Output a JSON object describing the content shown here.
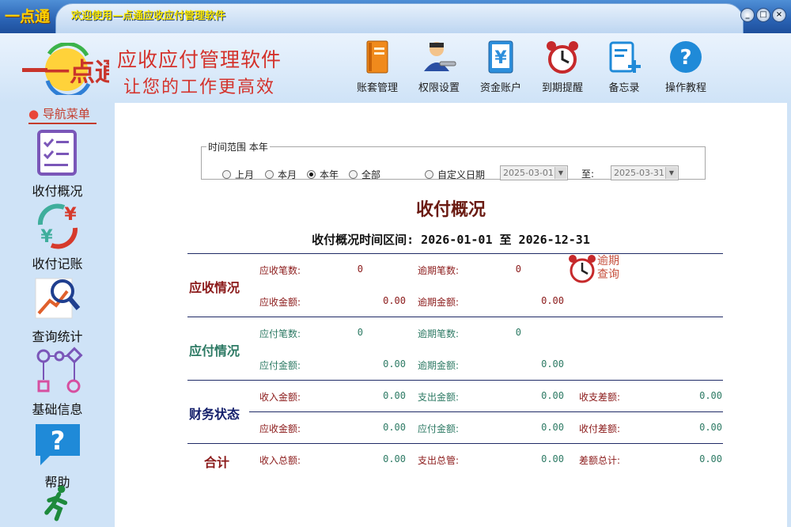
{
  "titlebar": {
    "logo": "一点通",
    "title": "欢迎使用—点通应收应付管理软件",
    "buttons": [
      "_",
      "□",
      "×"
    ]
  },
  "brand": {
    "logo": "一点通",
    "line1": "应收应付管理软件",
    "line2": "让您的工作更高效"
  },
  "toolbar": [
    {
      "label": "账套管理",
      "icon": "ledger-book-icon"
    },
    {
      "label": "权限设置",
      "icon": "user-key-icon"
    },
    {
      "label": "资金账户",
      "icon": "yuan-account-icon"
    },
    {
      "label": "到期提醒",
      "icon": "alarm-clock-icon"
    },
    {
      "label": "备忘录",
      "icon": "memo-add-icon"
    },
    {
      "label": "操作教程",
      "icon": "help-question-icon"
    }
  ],
  "sidebar": {
    "title": "导航菜单",
    "items": [
      {
        "label": "收付概况",
        "icon": "checklist-icon"
      },
      {
        "label": "收付记账",
        "icon": "yuan-exchange-icon"
      },
      {
        "label": "查询统计",
        "icon": "magnifier-chart-icon"
      },
      {
        "label": "基础信息",
        "icon": "flow-diagram-icon"
      },
      {
        "label": "帮助",
        "icon": "help-bubble-icon"
      },
      {
        "label": "",
        "icon": "running-man-icon"
      }
    ]
  },
  "range": {
    "legend": "时间范围 本年",
    "options": [
      "上月",
      "本月",
      "本年",
      "全部"
    ],
    "selected": "本年",
    "custom_label": "自定义日期",
    "start_date": "2025-03-01",
    "to_label": "至:",
    "end_date": "2025-03-31"
  },
  "summary": {
    "title": "收付概况",
    "period": "收付概况时间区间: 2026-01-01 至 2026-12-31",
    "overdue_label_1": "逾期",
    "overdue_label_2": "查询",
    "receivable": {
      "heading": "应收情况",
      "count_label": "应收笔数:",
      "count": "0",
      "overdue_count_label": "逾期笔数:",
      "overdue_count": "0",
      "amount_label": "应收金额:",
      "amount": "0.00",
      "overdue_amount_label": "逾期金额:",
      "overdue_amount": "0.00"
    },
    "payable": {
      "heading": "应付情况",
      "count_label": "应付笔数:",
      "count": "0",
      "overdue_count_label": "逾期笔数:",
      "overdue_count": "0",
      "amount_label": "应付金额:",
      "amount": "0.00",
      "overdue_amount_label": "逾期金额:",
      "overdue_amount": "0.00"
    },
    "finance": {
      "heading": "财务状态",
      "income_label": "收入金额:",
      "income": "0.00",
      "expense_label": "支出金额:",
      "expense": "0.00",
      "diff_label": "收支差额:",
      "diff": "0.00",
      "receivable_label": "应收金额:",
      "receivable": "0.00",
      "payable_label": "应付金额:",
      "payable": "0.00",
      "rp_diff_label": "收付差额:",
      "rp_diff": "0.00"
    },
    "total": {
      "heading": "合计",
      "income_label": "收入总额:",
      "income": "0.00",
      "expense_label": "支出总管:",
      "expense": "0.00",
      "diff_label": "差额总计:",
      "diff": "0.00"
    }
  }
}
